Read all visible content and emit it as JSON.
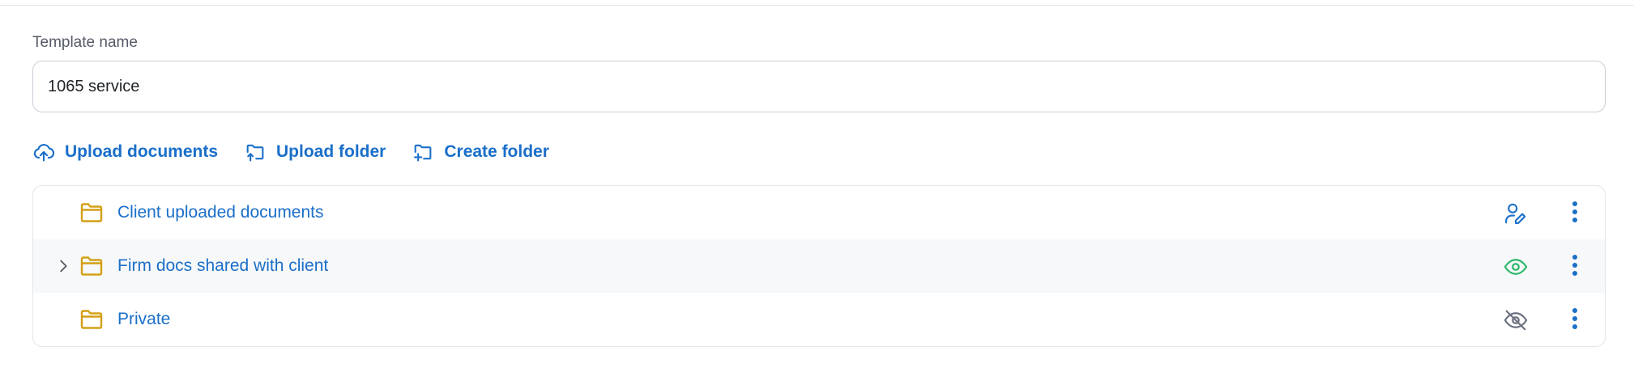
{
  "template": {
    "label": "Template name",
    "value": "1065 service"
  },
  "actions": {
    "upload_documents": "Upload documents",
    "upload_folder": "Upload folder",
    "create_folder": "Create folder"
  },
  "folders": [
    {
      "name": "Client uploaded documents",
      "expandable": false,
      "status_icon": "user-edit-icon",
      "status_color": "#1a6fc9"
    },
    {
      "name": "Firm docs shared with client",
      "expandable": true,
      "status_icon": "eye-icon",
      "status_color": "#2eb86b"
    },
    {
      "name": "Private",
      "expandable": false,
      "status_icon": "eye-off-icon",
      "status_color": "#6b7280"
    }
  ],
  "colors": {
    "accent": "#1a6fc9",
    "folder": "#d4a017",
    "shared_green": "#2eb86b",
    "hidden_gray": "#6b7280"
  }
}
